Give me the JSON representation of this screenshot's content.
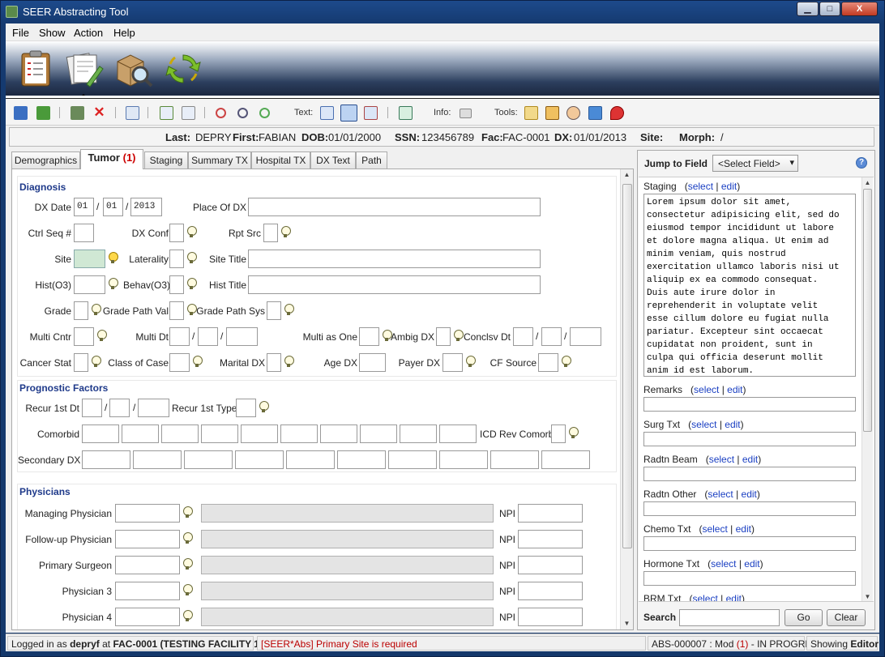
{
  "window": {
    "title": "SEER Abstracting Tool",
    "min": "▁",
    "max": "□",
    "close": "X"
  },
  "menu": [
    "File",
    "Show",
    "Action",
    "Help"
  ],
  "banner_icons": [
    "abstract-form-icon",
    "edit-pages-icon",
    "search-box-icon",
    "refresh-cycle-icon"
  ],
  "toolbar": {
    "text_label": "Text:",
    "info_label": "Info:",
    "tools_label": "Tools:"
  },
  "patient": {
    "last_label": "Last:",
    "last": "DEPRY",
    "first_label": "First:",
    "first": "FABIAN",
    "dob_label": "DOB:",
    "dob": "01/01/2000",
    "ssn_label": "SSN:",
    "ssn": "123456789",
    "fac_label": "Fac:",
    "fac": "FAC-0001",
    "dx_label": "DX:",
    "dx": "01/01/2013",
    "site_label": "Site:",
    "site": "",
    "morph_label": "Morph:",
    "morph": "/"
  },
  "tabs": [
    {
      "label": "Demographics"
    },
    {
      "label": "Tumor",
      "count": "(1)"
    },
    {
      "label": "Staging"
    },
    {
      "label": "Summary TX"
    },
    {
      "label": "Hospital TX"
    },
    {
      "label": "DX Text"
    },
    {
      "label": "Path"
    }
  ],
  "diagnosis": {
    "title": "Diagnosis",
    "dx_date_label": "DX Date",
    "dx_month": "01",
    "dx_day": "01",
    "dx_year": "2013",
    "place_of_dx_label": "Place Of DX",
    "ctrl_seq_label": "Ctrl Seq #",
    "dx_conf_label": "DX Conf",
    "rpt_src_label": "Rpt Src",
    "site_label": "Site",
    "laterality_label": "Laterality",
    "site_title_label": "Site Title",
    "hist_label": "Hist(O3)",
    "behav_label": "Behav(O3)",
    "hist_title_label": "Hist Title",
    "grade_label": "Grade",
    "grade_path_val_label": "Grade Path Val",
    "grade_path_sys_label": "Grade Path Sys",
    "multi_cntr_label": "Multi Cntr",
    "multi_dt_label": "Multi Dt",
    "multi_as_one_label": "Multi as One",
    "ambig_dx_label": "Ambig DX",
    "conclsv_dt_label": "Conclsv Dt",
    "cancer_stat_label": "Cancer Stat",
    "class_of_case_label": "Class of Case",
    "marital_dx_label": "Marital DX",
    "age_dx_label": "Age DX",
    "payer_dx_label": "Payer DX",
    "cf_source_label": "CF Source"
  },
  "prognostic": {
    "title": "Prognostic Factors",
    "recur_dt_label": "Recur 1st Dt",
    "recur_type_label": "Recur 1st Type",
    "comorbid_label": "Comorbid",
    "icd_rev_label": "ICD Rev Comorb",
    "secondary_dx_label": "Secondary DX"
  },
  "physicians": {
    "title": "Physicians",
    "npi_label": "NPI",
    "rows": [
      {
        "label": "Managing Physician"
      },
      {
        "label": "Follow-up Physician"
      },
      {
        "label": "Primary Surgeon"
      },
      {
        "label": "Physician 3"
      },
      {
        "label": "Physician 4"
      }
    ]
  },
  "right_panel": {
    "jump_label": "Jump to Field",
    "select_value": "<Select Field>",
    "help": "?",
    "select_link": "select",
    "edit_link": "edit",
    "staging_label": "Staging",
    "staging_text": "Lorem ipsum dolor sit amet,\nconsectetur adipisicing elit, sed do\neiusmod tempor incididunt ut labore\net dolore magna aliqua. Ut enim ad\nminim veniam, quis nostrud\nexercitation ullamco laboris nisi ut\naliquip ex ea commodo consequat.\nDuis aute irure dolor in\nreprehenderit in voluptate velit\nesse cillum dolore eu fugiat nulla\npariatur. Excepteur sint occaecat\ncupidatat non proident, sunt in\nculpa qui officia deserunt mollit\nanim id est laborum.",
    "fields": [
      {
        "label": "Remarks"
      },
      {
        "label": "Surg Txt"
      },
      {
        "label": "Radtn Beam"
      },
      {
        "label": "Radtn Other"
      },
      {
        "label": "Chemo Txt"
      },
      {
        "label": "Hormone Txt"
      },
      {
        "label": "BRM Txt"
      }
    ],
    "search_label": "Search",
    "go_label": "Go",
    "clear_label": "Clear"
  },
  "status": {
    "logged_prefix": "Logged in as",
    "user": "depryf",
    "at": "at",
    "facility": "FAC-0001 (TESTING FACILITY 1)",
    "error": "[SEER*Abs] Primary Site is required",
    "abs_prefix": "ABS-000007 : Mod",
    "abs_count": "(1)",
    "abs_suffix": "- IN PROGRESS",
    "showing_prefix": "Showing",
    "showing_mode": "Editor"
  }
}
